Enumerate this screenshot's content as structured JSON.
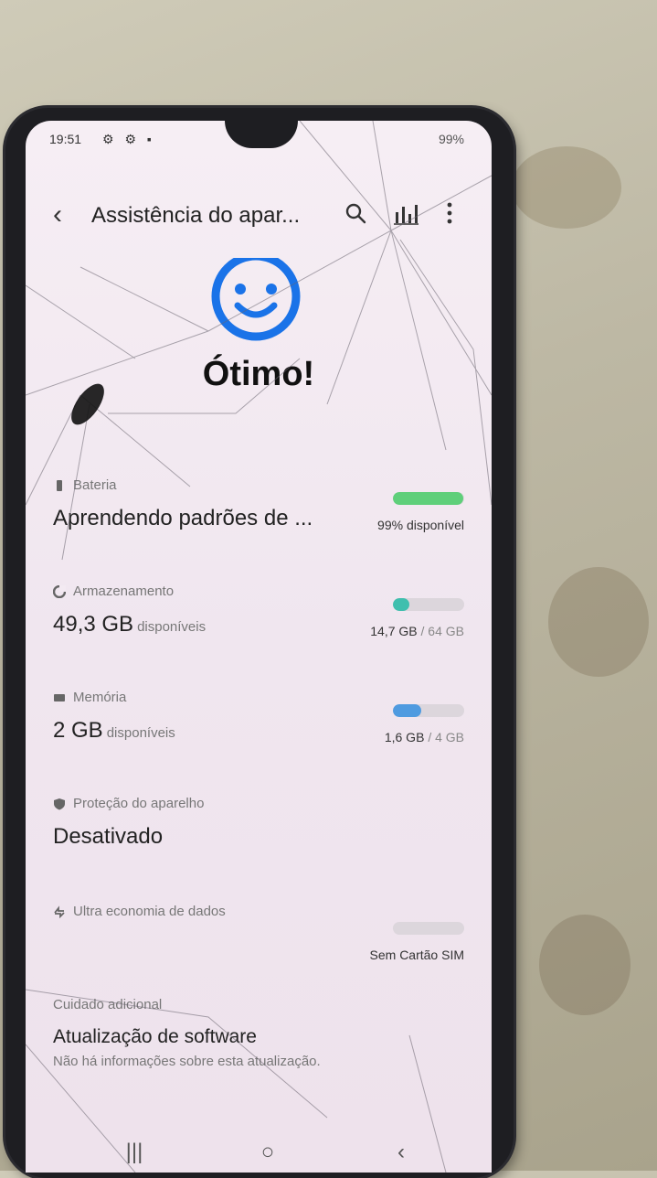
{
  "status_bar": {
    "time": "19:51",
    "left_icons": "⚙ ⚙ ▪",
    "right": "99%"
  },
  "app_bar": {
    "title": "Assistência do apar...",
    "back_icon": "chevron-left-icon",
    "search_icon": "search-icon",
    "stats_icon": "bar-chart-icon",
    "more_icon": "more-vertical-icon"
  },
  "headline": "Ótimo!",
  "battery": {
    "label": "Bateria",
    "value": "Aprendendo padrões de ...",
    "caption": "99% disponível",
    "level": 0.99,
    "color": "#5fcf7a"
  },
  "storage": {
    "label": "Armazenamento",
    "value": "49,3 GB",
    "value_suffix": "disponíveis",
    "used": "14,7 GB",
    "total": "/ 64 GB",
    "level": 0.23,
    "color": "#3fbfae"
  },
  "memory": {
    "label": "Memória",
    "value": "2 GB",
    "value_suffix": "disponíveis",
    "used": "1,6 GB",
    "total": "/ 4 GB",
    "level": 0.4,
    "color": "#4f9be0"
  },
  "protection": {
    "label": "Proteção do aparelho",
    "value": "Desativado"
  },
  "data_saver": {
    "label": "Ultra economia de dados",
    "caption": "Sem Cartão SIM",
    "level": 0
  },
  "extra": {
    "subhead": "Cuidado adicional",
    "update_title": "Atualização de software",
    "update_desc": "Não há informações sobre esta atualização."
  },
  "nav": {
    "recents": "|||",
    "home": "○",
    "back": "‹"
  },
  "colors": {
    "accent": "#1a73e8",
    "screen_bg": "#f3eaf2"
  }
}
